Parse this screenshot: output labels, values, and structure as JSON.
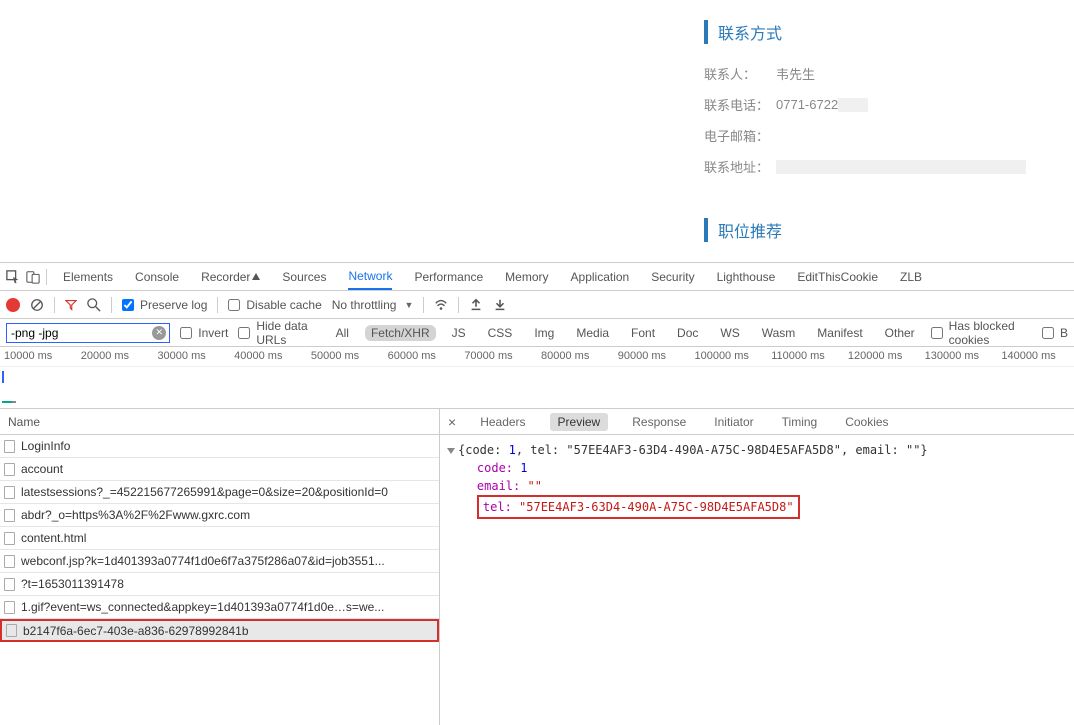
{
  "page": {
    "contact": {
      "title": "联系方式",
      "rows": {
        "person_label": "联系人：",
        "person_value": "韦先生",
        "phone_label": "联系电话：",
        "phone_value": "0771-6722",
        "email_label": "电子邮箱：",
        "email_value": "",
        "address_label": "联系地址：",
        "address_value": ""
      }
    },
    "jobs": {
      "title": "职位推荐"
    }
  },
  "devtools": {
    "tabs": [
      "Elements",
      "Console",
      "Recorder",
      "Sources",
      "Network",
      "Performance",
      "Memory",
      "Application",
      "Security",
      "Lighthouse",
      "EditThisCookie",
      "ZLB"
    ],
    "active_tab": "Network",
    "controls": {
      "preserve_log": "Preserve log",
      "disable_cache": "Disable cache",
      "throttling": "No throttling"
    },
    "filter": {
      "input_value": "-png -jpg",
      "invert": "Invert",
      "hide_data_urls": "Hide data URLs",
      "types": [
        "All",
        "Fetch/XHR",
        "JS",
        "CSS",
        "Img",
        "Media",
        "Font",
        "Doc",
        "WS",
        "Wasm",
        "Manifest",
        "Other"
      ],
      "selected_type": "Fetch/XHR",
      "has_blocked": "Has blocked cookies",
      "b_partial": "B"
    },
    "timeline_labels": [
      "10000 ms",
      "20000 ms",
      "30000 ms",
      "40000 ms",
      "50000 ms",
      "60000 ms",
      "70000 ms",
      "80000 ms",
      "90000 ms",
      "100000 ms",
      "110000 ms",
      "120000 ms",
      "130000 ms",
      "140000 ms"
    ],
    "name_header": "Name",
    "requests": [
      "LoginInfo",
      "account",
      "latestsessions?_=452215677265991&page=0&size=20&positionId=0",
      "abdr?_o=https%3A%2F%2Fwww.gxrc.com",
      "content.html",
      "webconf.jsp?k=1d401393a0774f1d0e6f7a375f286a07&id=job3551...",
      "?t=1653011391478",
      "1.gif?event=ws_connected&appkey=1d401393a0774f1d0e…s=we...",
      "b2147f6a-6ec7-403e-a836-62978992841b"
    ],
    "selected_request_index": 8,
    "highlighted_request_index": 8,
    "detail_tabs": [
      "Headers",
      "Preview",
      "Response",
      "Initiator",
      "Timing",
      "Cookies"
    ],
    "detail_active": "Preview",
    "json": {
      "summary_parts": {
        "prefix": "{code: ",
        "code_val": "1",
        "tel_label": ", tel: ",
        "tel_val": "\"57EE4AF3-63D4-490A-A75C-98D4E5AFA5D8\"",
        "email_label": ", email: ",
        "email_val": "\"\"",
        "suffix": "}"
      },
      "code_key": "code: ",
      "code_val": "1",
      "email_key": "email: ",
      "email_val": "\"\"",
      "tel_key": "tel: ",
      "tel_val": "\"57EE4AF3-63D4-490A-A75C-98D4E5AFA5D8\""
    }
  }
}
